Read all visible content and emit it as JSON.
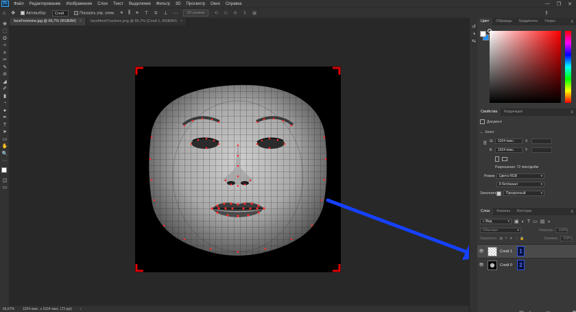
{
  "menu": {
    "logo": "Ps",
    "items": [
      "Файл",
      "Редактирование",
      "Изображение",
      "Слои",
      "Текст",
      "Выделение",
      "Фильтр",
      "3D",
      "Просмотр",
      "Окно",
      "Справка"
    ],
    "win_min": "—",
    "win_max": "❐",
    "win_close": "✕"
  },
  "options": {
    "autoselect_label": "Автовыбор:",
    "autoselect_value": "Слой",
    "show_transform_label": "Показать упр. элем.",
    "mode3d_label": "3D-режим:"
  },
  "tabs": [
    {
      "title": "faceFeminine.jpg @ 66,7% (RGB/8#)",
      "close": "×"
    },
    {
      "title": "faceMeshTrackers.png @ 66,7% (Слой 1, RGB/8#)",
      "close": "×"
    }
  ],
  "status": {
    "zoom": "66,67%",
    "info": "1024 пикс. x 1024 пикс. (72 ppi)",
    "arrow": "›"
  },
  "color_panel": {
    "tabs": [
      "Цвет",
      "Образцы",
      "Градиенты",
      "Узоры"
    ],
    "menu": "≡",
    "hue_color": "#ff0000"
  },
  "properties": {
    "tabs": [
      "Свойства",
      "Коррекция"
    ],
    "doc_label": "Документ",
    "canvas_header": "Холст",
    "w_label": "Ш",
    "h_label": "В",
    "w_value": "1024 пикс.",
    "h_value": "1024 пикс.",
    "x_label": "X",
    "y_label": "Y",
    "resolution": "Разрешение: 72 пикс/дюйм",
    "mode_label": "Режим",
    "mode_value": "Цвета RGB",
    "depth_value": "8 бит/канал",
    "fill_label": "Заполнить",
    "fill_value": "Прозрачный"
  },
  "layers": {
    "tabs": [
      "Слои",
      "Каналы",
      "Контуры"
    ],
    "kind_value": "Вид",
    "blend_value": "Обычные",
    "opacity_label": "Непрозр.:",
    "opacity_value": "100%",
    "lock_label": "Закрепить:",
    "fill_label": "Заливка:",
    "fill_value": "100%",
    "items": [
      {
        "name": "Слой 1",
        "badge": "1",
        "visible": "👁"
      },
      {
        "name": "Слой 0",
        "badge": "2",
        "visible": "👁"
      }
    ],
    "bottom_icons": [
      "⛓",
      "fx",
      "◐",
      "▣",
      "▭",
      "+",
      "🗑"
    ]
  },
  "tools": [
    "✥",
    "⬚",
    "ʘ",
    "✧",
    "⌗",
    "✂",
    "✎",
    "⊘",
    "◢",
    "✐",
    "▮",
    "◔",
    "●",
    "✒",
    "T",
    "➤",
    "▭",
    "✋",
    "🔍",
    "···"
  ],
  "colors": {
    "accent": "#31a8ff",
    "arrow": "#1541ff",
    "corner": "#e00000",
    "badge": "#2e55e8"
  }
}
